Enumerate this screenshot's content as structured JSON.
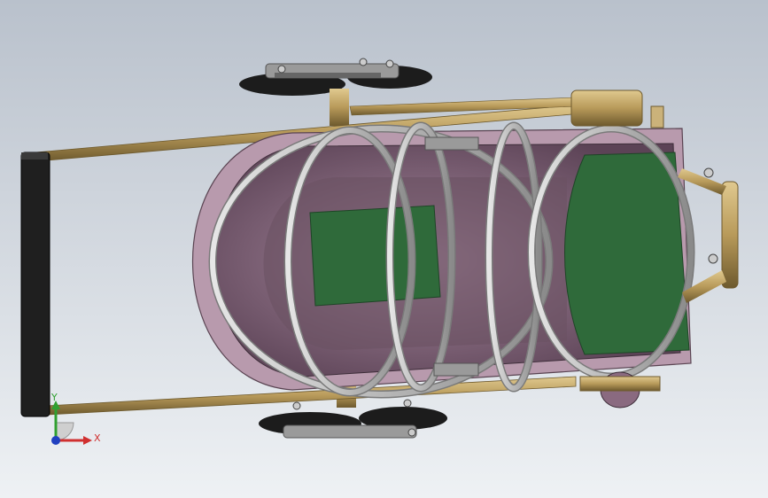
{
  "triad": {
    "x_label": "X",
    "y_label": "Y"
  },
  "colors": {
    "background_top": "#bfc6d0",
    "background_bottom": "#eef1f4",
    "frame_tube": "#b89a5a",
    "handle_grip": "#222222",
    "bassinet_shell": "#8a6a80",
    "bassinet_inner": "#5a4452",
    "mat": "#2f6a3a",
    "hoop": "#b8b8b8",
    "wheel": "#1c1c1c",
    "axis_x": "#d03030",
    "axis_y": "#30a030",
    "axis_z": "#2040c0"
  }
}
